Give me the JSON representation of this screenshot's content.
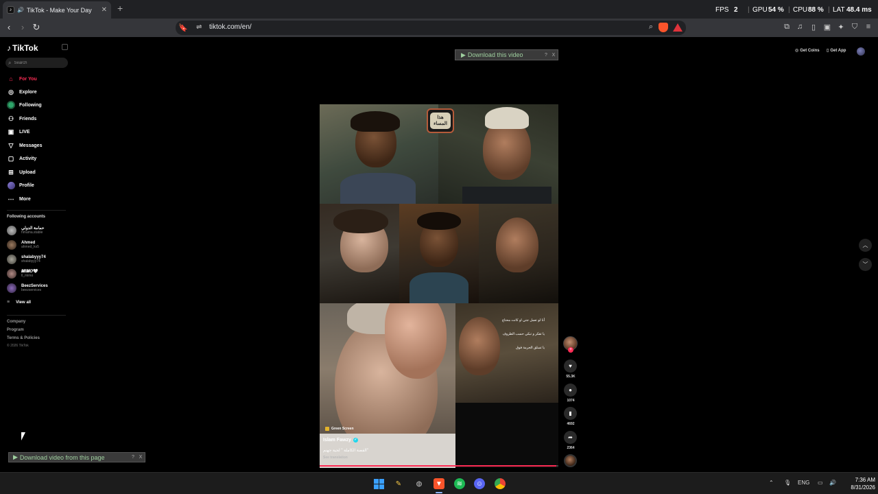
{
  "browser": {
    "tab_title": "TikTok - Make Your Day",
    "tab_close": "✕",
    "new_tab": "+",
    "url": "tiktok.com/en/",
    "overlay": {
      "fps_label": "FPS",
      "fps_value": "2",
      "gpu_label": "GPU",
      "gpu_value": "54 %",
      "cpu_label": "CPU",
      "cpu_value": "88 %",
      "lat_label": "LAT",
      "lat_value": "48.4 ms"
    }
  },
  "tiktok": {
    "logo": "TikTok",
    "search_placeholder": "Search",
    "menu": [
      {
        "label": "For You",
        "icon": "home-icon",
        "active": true
      },
      {
        "label": "Explore",
        "icon": "compass-icon"
      },
      {
        "label": "Following",
        "icon": "following-icon"
      },
      {
        "label": "Friends",
        "icon": "friends-icon"
      },
      {
        "label": "LIVE",
        "icon": "live-icon"
      },
      {
        "label": "Messages",
        "icon": "messages-icon"
      },
      {
        "label": "Activity",
        "icon": "activity-icon"
      },
      {
        "label": "Upload",
        "icon": "upload-icon"
      },
      {
        "label": "Profile",
        "icon": "profile-icon"
      },
      {
        "label": "More",
        "icon": "more-icon"
      }
    ],
    "following_title": "Following accounts",
    "accounts": [
      {
        "nick": "حمامة الدولي",
        "user": "hmama.stable",
        "color": "#8a8a8a"
      },
      {
        "nick": "Ahmed",
        "user": "ahmed_ks5",
        "color": "#5d4634"
      },
      {
        "nick": "shalabyyy74",
        "user": "shalabyyy74",
        "color": "#6d6a60"
      },
      {
        "nick": "𝑴𝑰𝑴𝑶🤍",
        "user": "ll_mimo",
        "color": "#7a5d5a"
      },
      {
        "nick": "BeezServices",
        "user": "beezservices",
        "color": "#5a3f7a"
      }
    ],
    "view_all": "View all",
    "footer": [
      "Company",
      "Program",
      "Terms & Policies"
    ],
    "copyright": "© 2026 TikTok",
    "get_coins": "Get Coins",
    "get_app": "Get App"
  },
  "extension": {
    "download_video": "Download this video",
    "download_page": "Download video from this page",
    "help": "?",
    "close": "X"
  },
  "video": {
    "logo_text": "هذا المساء",
    "subtitles": [
      "أنا لو تعمل جتي او كانت محتاج",
      "يا تفكر و تبكي حسب الظروف",
      "يا تسلق الحرمة فوق"
    ],
    "tag": "Green Screen",
    "creator": "Islam Fawzy",
    "caption": "القصة الكاملة \" لحية جهنم\"",
    "see_translation": "See translation",
    "progress_fraction": 0.99,
    "likes": "55.3K",
    "comments": "1074",
    "saves": "4692",
    "shares": "2364"
  },
  "taskbar": {
    "lang": "ENG",
    "time": "7:36 AM",
    "date": "8/31/2026"
  }
}
